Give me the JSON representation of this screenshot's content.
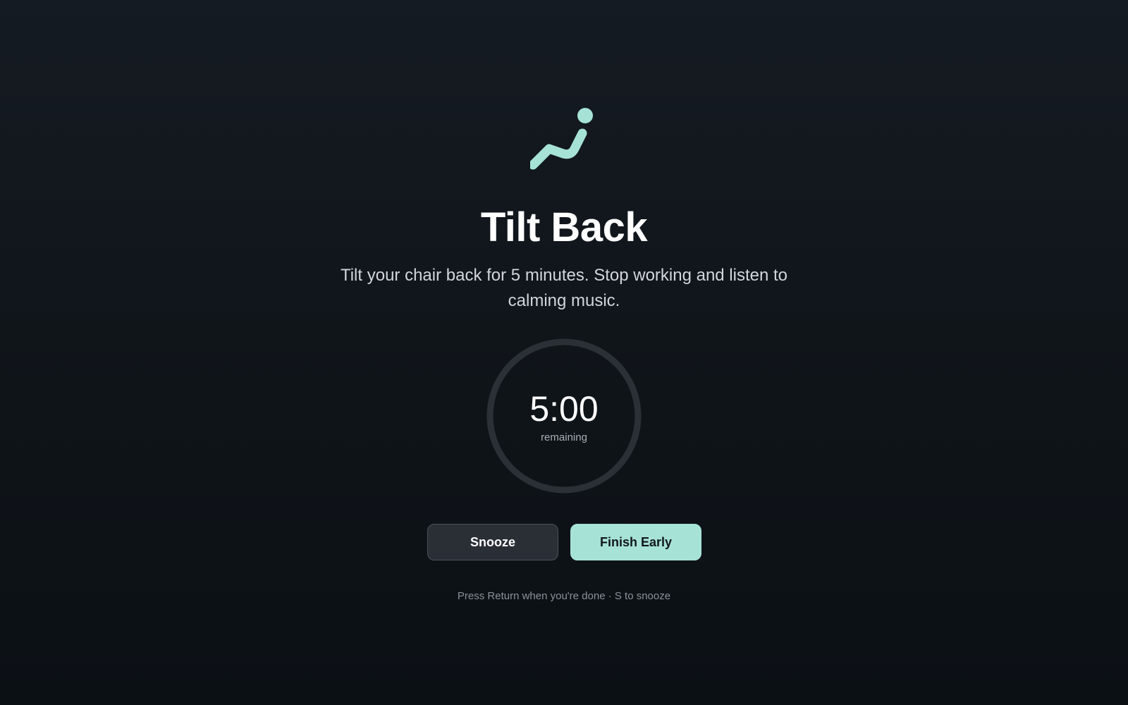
{
  "activity": {
    "icon": "reclining-person-icon",
    "title": "Tilt Back",
    "description": "Tilt your chair back for 5 minutes. Stop working and listen to calming music."
  },
  "timer": {
    "value": "5:00",
    "caption": "remaining",
    "progress": 0
  },
  "actions": {
    "snooze_label": "Snooze",
    "finish_label": "Finish Early"
  },
  "hint": "Press Return when you're done · S to snooze",
  "colors": {
    "accent": "#a6e3d6",
    "ring_track": "#2b3036",
    "background": "#11161c"
  }
}
